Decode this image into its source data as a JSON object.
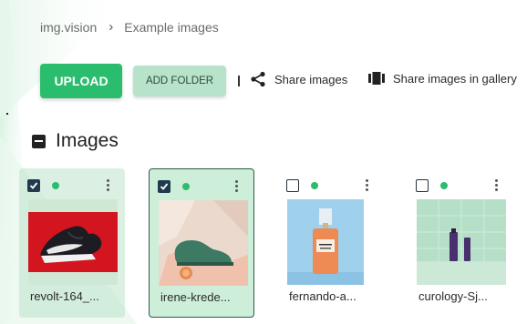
{
  "breadcrumb": {
    "items": [
      "img.vision",
      "Example images"
    ]
  },
  "toolbar": {
    "upload_label": "UPLOAD",
    "add_folder_label": "ADD FOLDER",
    "share_images_label": "Share images",
    "share_gallery_label": "Share images in gallery"
  },
  "section": {
    "title": "Images"
  },
  "images": [
    {
      "name": "revolt-164_...",
      "selected": true,
      "status": "green"
    },
    {
      "name": "irene-krede...",
      "selected": true,
      "status": "green"
    },
    {
      "name": "fernando-a...",
      "selected": false,
      "status": "green"
    },
    {
      "name": "curology-Sj...",
      "selected": false,
      "status": "green"
    }
  ],
  "colors": {
    "accent": "#2bbd6e",
    "button_secondary": "#b8e3cb",
    "checkbox_checked": "#1f3b4d",
    "selected_card": "#cdeed9"
  }
}
